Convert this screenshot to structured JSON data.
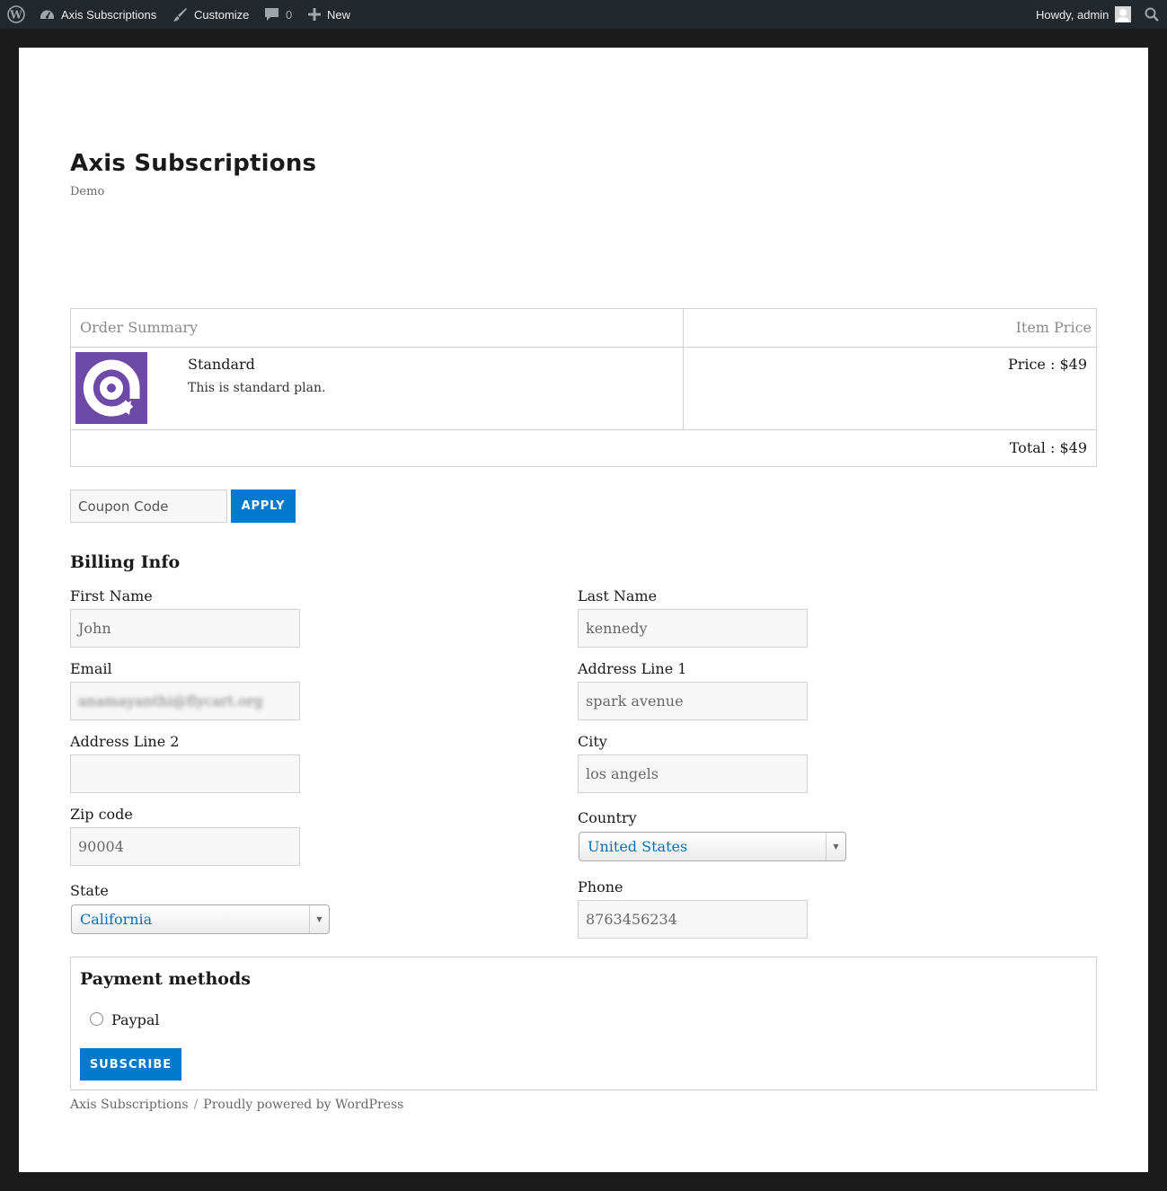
{
  "admin_bar": {
    "site_name": "Axis Subscriptions",
    "customize": "Customize",
    "comments_count": "0",
    "new_label": "New",
    "greeting": "Howdy, admin"
  },
  "site": {
    "title": "Axis Subscriptions",
    "description": "Demo"
  },
  "order": {
    "header_left": "Order Summary",
    "header_right": "Item Price",
    "plan_name": "Standard",
    "plan_desc": "This is standard plan.",
    "price": "Price : $49",
    "total": "Total : $49"
  },
  "coupon": {
    "placeholder": "Coupon Code",
    "apply_label": "APPLY"
  },
  "billing": {
    "heading": "Billing Info",
    "first_name": {
      "label": "First Name",
      "value": "John"
    },
    "last_name": {
      "label": "Last Name",
      "value": "kennedy"
    },
    "email": {
      "label": "Email",
      "value": "anamayanthi@flycart.org"
    },
    "address1": {
      "label": "Address Line 1",
      "value": "spark avenue"
    },
    "address2": {
      "label": "Address Line 2",
      "value": ""
    },
    "city": {
      "label": "City",
      "value": "los angels"
    },
    "zip": {
      "label": "Zip code",
      "value": "90004"
    },
    "country": {
      "label": "Country",
      "value": "United States"
    },
    "state": {
      "label": "State",
      "value": "California"
    },
    "phone": {
      "label": "Phone",
      "value": "8763456234"
    }
  },
  "payment": {
    "heading": "Payment methods",
    "option": "Paypal",
    "subscribe_label": "SUBSCRIBE"
  },
  "footer": {
    "site_link": "Axis Subscriptions",
    "separator": "/",
    "powered": "Proudly powered by WordPress"
  },
  "colors": {
    "accent": "#007acc",
    "logo_bg": "#6d4aa8",
    "admin_bar": "#23282d"
  }
}
